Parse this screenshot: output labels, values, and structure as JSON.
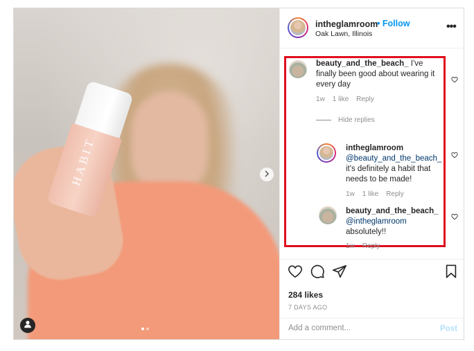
{
  "post": {
    "author": {
      "username": "intheglamroom",
      "location": "Oak Lawn, Illinois"
    },
    "follow_separator": "•",
    "follow_label": "Follow",
    "more_label": "•••",
    "photo": {
      "bottle_text": "HABIT",
      "carousel_pages": 2,
      "carousel_active": 1
    }
  },
  "comments": [
    {
      "username": "beauty_and_the_beach_",
      "text": "I've finally been good about wearing it every day",
      "age": "1w",
      "likes": "1 like",
      "reply_label": "Reply"
    }
  ],
  "hide_replies_label": "Hide replies",
  "replies": [
    {
      "username": "intheglamroom",
      "mention": "@beauty_and_the_beach_",
      "text": "it's definitely a habit that needs to be made!",
      "age": "1w",
      "likes": "1 like",
      "reply_label": "Reply"
    },
    {
      "username": "beauty_and_the_beach_",
      "mention": "@intheglamroom",
      "text": "absolutely!!",
      "age": "1w",
      "reply_label": "Reply"
    }
  ],
  "actions": {
    "icons": [
      "heart-icon",
      "comment-icon",
      "share-icon",
      "bookmark-icon"
    ],
    "likes_text": "284 likes",
    "time_ago": "7 DAYS AGO"
  },
  "add_comment": {
    "placeholder": "Add a comment...",
    "post_label": "Post"
  },
  "colors": {
    "accent": "#0095f6",
    "highlight": "#e00b1c",
    "muted": "#8e8e8e"
  }
}
